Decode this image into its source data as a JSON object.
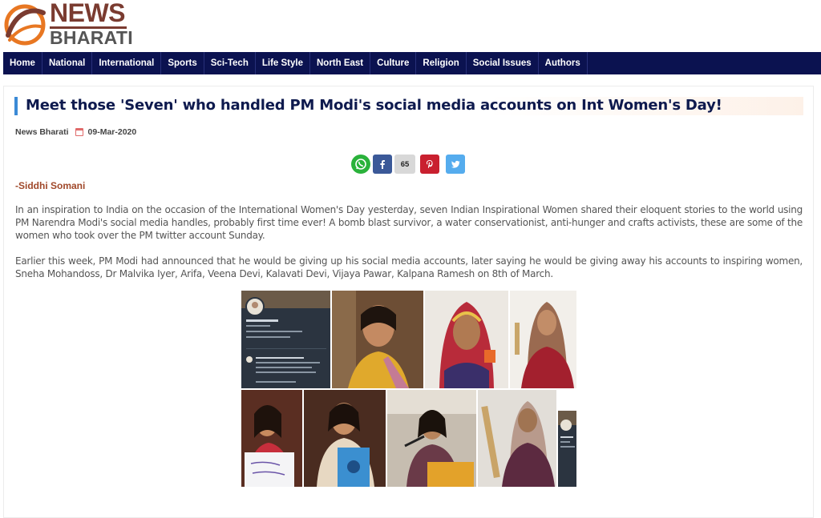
{
  "site": {
    "logo_top": "NEWS",
    "logo_bottom": "BHARATI"
  },
  "nav": {
    "items": [
      "Home",
      "National",
      "International",
      "Sports",
      "Sci-Tech",
      "Life Style",
      "North East",
      "Culture",
      "Religion",
      "Social Issues",
      "Authors"
    ]
  },
  "article": {
    "title": "Meet those 'Seven' who handled PM Modi's social media accounts on Int Women's Day!",
    "author": "News Bharati",
    "date": "09-Mar-2020",
    "share_count": "65",
    "byline": "-Siddhi Somani",
    "paragraphs": [
      "In an inspiration to India on the occasion of the International Women's Day yesterday, seven Indian Inspirational Women shared their eloquent stories to the world using PM Narendra Modi's social media handles, probably first time ever! A bomb blast survivor, a water conservationist, anti-hunger and crafts activists, these are some of the women who took over the PM twitter account Sunday.",
      "Earlier this week, PM Modi had announced that he would be giving up his social media accounts, later saying he would be giving away his accounts to inspiring women, Sneha Mohandoss, Dr Malvika Iyer, Arifa, Veena Devi, Kalavati Devi, Vijaya Pawar, Kalpana Ramesh on 8th of March."
    ]
  },
  "colors": {
    "nav_bg": "#0b1250",
    "title": "#0e1a4e",
    "accent_bar": "#3b8ad6",
    "byline": "#a0482a",
    "whatsapp": "#2ab23b",
    "facebook": "#3b5998",
    "pinterest": "#c9202f",
    "twitter": "#55acee"
  },
  "icons": [
    "news-bharati-logo-icon",
    "calendar-icon",
    "whatsapp-icon",
    "facebook-icon",
    "pinterest-icon",
    "twitter-icon"
  ]
}
